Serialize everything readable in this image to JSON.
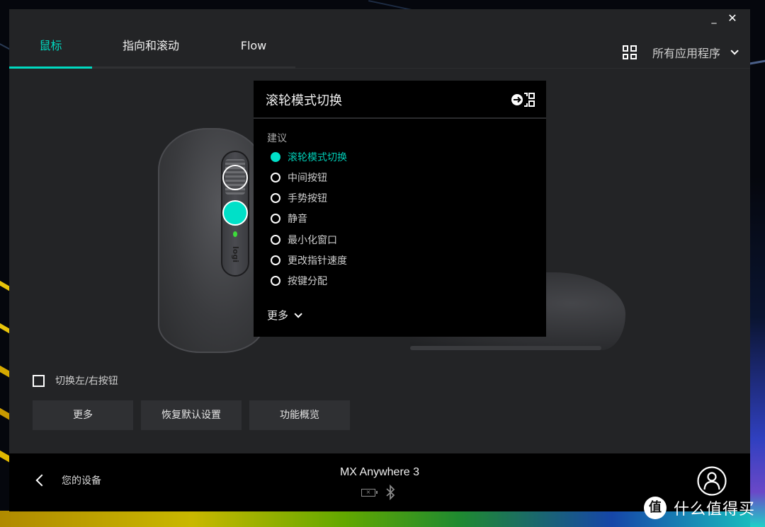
{
  "window": {
    "controls": {
      "minimize_label": "_",
      "close_label": "✕"
    }
  },
  "tabs": [
    {
      "label": "鼠标",
      "active": true
    },
    {
      "label": "指向和滚动",
      "active": false
    },
    {
      "label": "Flow",
      "active": false
    }
  ],
  "app_selector": {
    "icon": "grid-icon",
    "label": "所有应用程序"
  },
  "mouse_illustration": {
    "logo_text": "logi"
  },
  "popup": {
    "title": "滚轮模式切换",
    "section_label": "建议",
    "options": [
      {
        "label": "滚轮模式切换",
        "selected": true
      },
      {
        "label": "中间按钮",
        "selected": false
      },
      {
        "label": "手势按钮",
        "selected": false
      },
      {
        "label": "静音",
        "selected": false
      },
      {
        "label": "最小化窗口",
        "selected": false
      },
      {
        "label": "更改指针速度",
        "selected": false
      },
      {
        "label": "按键分配",
        "selected": false
      }
    ],
    "more_label": "更多"
  },
  "controls": {
    "swap_buttons_label": "切换左/右按钮",
    "swap_buttons_checked": false,
    "buttons": [
      {
        "label": "更多"
      },
      {
        "label": "恢复默认设置"
      },
      {
        "label": "功能概览"
      }
    ]
  },
  "footer": {
    "back_label": "您的设备",
    "device_name": "MX Anywhere 3",
    "battery_status": "unknown",
    "connection": "bluetooth"
  },
  "watermark": {
    "badge": "值",
    "text": "什么值得买"
  },
  "colors": {
    "accent": "#00d9c0",
    "window_bg": "#232426",
    "popup_bg": "#000000",
    "footer_bg": "#000000"
  }
}
